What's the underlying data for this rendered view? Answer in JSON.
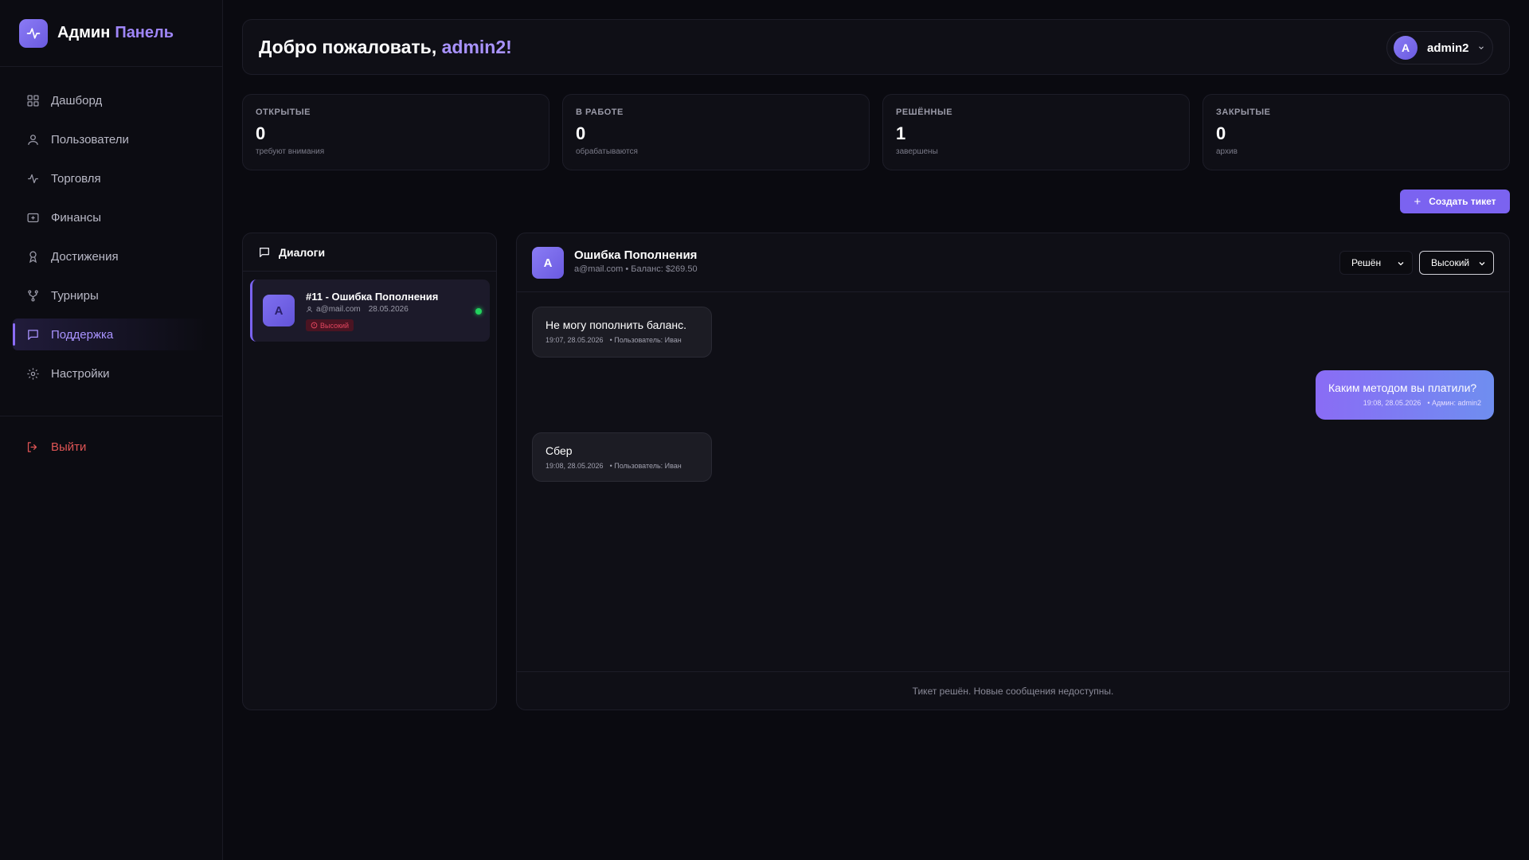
{
  "brand": {
    "name": "Админ",
    "accent": "Панель"
  },
  "sidebar": {
    "items": [
      {
        "label": "Дашборд",
        "icon": "grid-icon"
      },
      {
        "label": "Пользователи",
        "icon": "user-icon"
      },
      {
        "label": "Торговля",
        "icon": "activity-icon"
      },
      {
        "label": "Финансы",
        "icon": "wallet-icon"
      },
      {
        "label": "Достижения",
        "icon": "award-icon"
      },
      {
        "label": "Турниры",
        "icon": "tournament-icon"
      },
      {
        "label": "Поддержка",
        "icon": "message-icon",
        "active": true
      },
      {
        "label": "Настройки",
        "icon": "gear-icon"
      }
    ],
    "logout": "Выйти"
  },
  "header": {
    "welcome": "Добро пожаловать, ",
    "username": "admin2!",
    "user": {
      "initial": "A",
      "name": "admin2"
    }
  },
  "stats": [
    {
      "label": "ОТКРЫТЫЕ",
      "value": "0",
      "sub": "требуют внимания"
    },
    {
      "label": "В РАБОТЕ",
      "value": "0",
      "sub": "обрабатываются"
    },
    {
      "label": "РЕШЁННЫЕ",
      "value": "1",
      "sub": "завершены"
    },
    {
      "label": "ЗАКРЫТЫЕ",
      "value": "0",
      "sub": "архив"
    }
  ],
  "create_ticket": "Создать тикет",
  "dialogs": {
    "title": "Диалоги",
    "items": [
      {
        "initial": "A",
        "title": "#11 - Ошибка Пополнения",
        "email": "a@mail.com",
        "date": "28.05.2026",
        "priority": "Высокий",
        "online": true
      }
    ]
  },
  "chat": {
    "initial": "A",
    "title": "Ошибка Пополнения",
    "subtitle": "a@mail.com • Баланс: $269.50",
    "status": "Решён",
    "priority": "Высокий",
    "messages": [
      {
        "text": "Не могу пополнить баланс.",
        "time": "19:07, 28.05.2026",
        "who": "• Пользователь: Иван",
        "side": "in"
      },
      {
        "text": "Каким методом вы платили?",
        "time": "19:08, 28.05.2026",
        "who": "• Админ: admin2",
        "side": "out"
      },
      {
        "text": "Сбер",
        "time": "19:08, 28.05.2026",
        "who": "• Пользователь: Иван",
        "side": "in"
      }
    ],
    "footer": "Тикет решён. Новые сообщения недоступны."
  },
  "colors": {
    "accent": "#7b63f0",
    "danger": "#e05555",
    "online": "#22d35e"
  }
}
